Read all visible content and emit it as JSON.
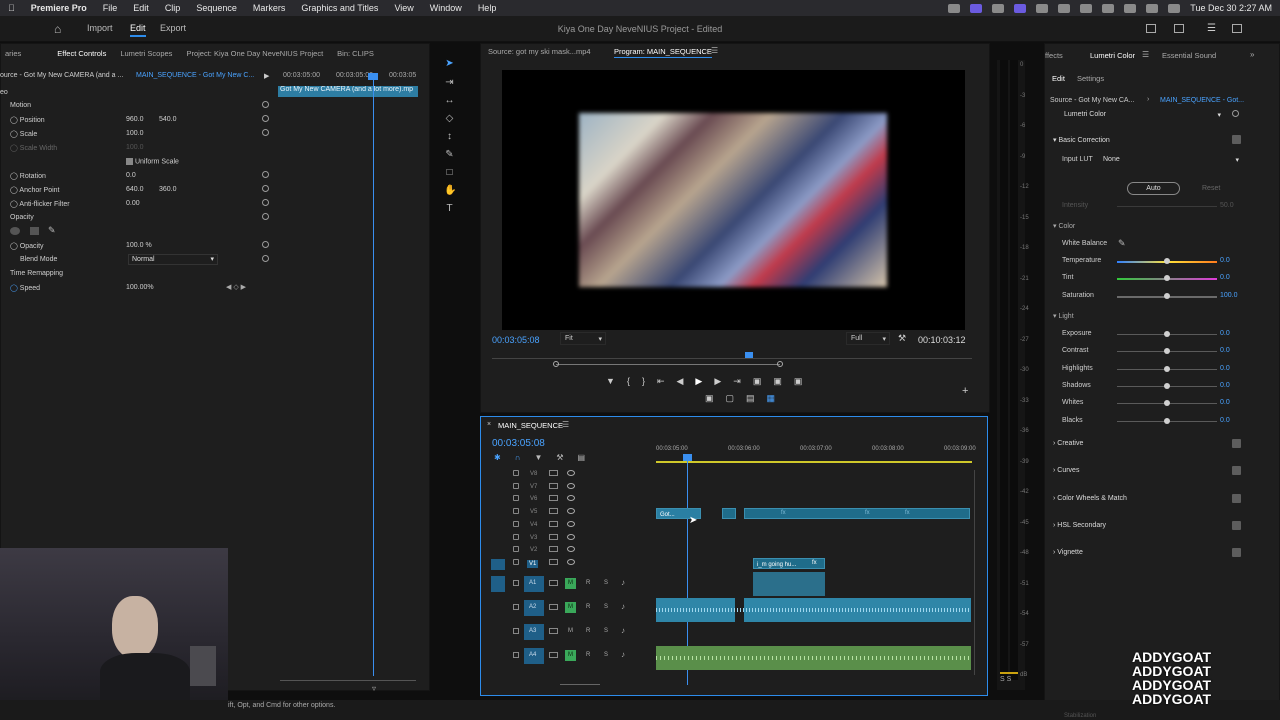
{
  "menubar": {
    "app": "Premiere Pro",
    "items": [
      "File",
      "Edit",
      "Clip",
      "Sequence",
      "Markers",
      "Graphics and Titles",
      "View",
      "Window",
      "Help"
    ],
    "clock": "Tue Dec 30  2:27 AM"
  },
  "header": {
    "tabs": [
      "Import",
      "Edit",
      "Export"
    ],
    "title": "Kiya One Day NeveNIUS Project - Edited"
  },
  "effect_controls": {
    "tabs": [
      "aries",
      "Effect Controls",
      "Lumetri Scopes",
      "Project: Kiya One Day NeveNIUS Project",
      "Bin: CLIPS"
    ],
    "source": "ource - Got My New CAMERA (and a ...",
    "sequence": "MAIN_SEQUENCE - Got My New C...",
    "times": [
      "00:03:05:00",
      "00:03:05:00",
      "00:03:05"
    ],
    "clip_label": "Got My New CAMERA (and a lot more).mp",
    "sections": {
      "motion": "Motion",
      "opacity": "Opacity",
      "time_remap": "Time Remapping",
      "video": "eo"
    },
    "props": [
      {
        "name": "Position",
        "v1": "960.0",
        "v2": "540.0"
      },
      {
        "name": "Scale",
        "v1": "100.0",
        "v2": ""
      },
      {
        "name": "Scale Width",
        "v1": "100.0",
        "v2": ""
      },
      {
        "name": "Rotation",
        "v1": "0.0",
        "v2": ""
      },
      {
        "name": "Anchor Point",
        "v1": "640.0",
        "v2": "360.0"
      },
      {
        "name": "Anti-flicker Filter",
        "v1": "0.00",
        "v2": ""
      }
    ],
    "uniform_scale": "Uniform Scale",
    "opacity_label": "Opacity",
    "opacity_value": "100.0 %",
    "blend_label": "Blend Mode",
    "blend_value": "Normal",
    "speed_label": "Speed",
    "speed_value": "100.00%"
  },
  "monitor": {
    "source_tab": "Source: got my ski mask...mp4",
    "program_tab": "Program: MAIN_SEQUENCE",
    "timecode": "00:03:05:08",
    "fit": "Fit",
    "quality": "Full",
    "duration": "00:10:03:12"
  },
  "timeline": {
    "name": "MAIN_SEQUENCE",
    "timecode": "00:03:05:08",
    "ruler": [
      "00:03:05:00",
      "00:03:06:00",
      "00:03:07:00",
      "00:03:08:00",
      "00:03:09:00"
    ],
    "video_tracks": [
      "V8",
      "V7",
      "V6",
      "V5",
      "V4",
      "V3",
      "V2",
      "V1"
    ],
    "audio_tracks": [
      "A1",
      "A2",
      "A3",
      "A4"
    ],
    "clip_v5": "Got...",
    "clip_v1": "i_m going hu...",
    "fx": "fx",
    "m": "M",
    "r": "R",
    "s": "S"
  },
  "audio_meter": {
    "ticks": [
      "0",
      "-3",
      "-6",
      "-9",
      "-12",
      "-15",
      "-18",
      "-21",
      "-24",
      "-27",
      "-30",
      "-33",
      "-36",
      "-39",
      "-42",
      "-45",
      "-48",
      "-51",
      "-54",
      "-57",
      "dB"
    ],
    "solo": "S  S"
  },
  "lumetri": {
    "tabs": [
      "ffects",
      "Lumetri Color",
      "Essential Sound"
    ],
    "subtabs": [
      "Edit",
      "Settings"
    ],
    "source": "Source - Got My New CA...",
    "sequence": "MAIN_SEQUENCE - Got...",
    "effect": "Lumetri Color",
    "basic": "Basic Correction",
    "input_lut_label": "Input LUT",
    "input_lut": "None",
    "auto": "Auto",
    "reset": "Reset",
    "intensity": "Intensity",
    "intensity_val": "50.0",
    "color": "Color",
    "white_balance": "White Balance",
    "light": "Light",
    "color_rows": [
      {
        "name": "Temperature",
        "value": "0.0"
      },
      {
        "name": "Tint",
        "value": "0.0"
      },
      {
        "name": "Saturation",
        "value": "100.0"
      }
    ],
    "light_rows": [
      {
        "name": "Exposure",
        "value": "0.0"
      },
      {
        "name": "Contrast",
        "value": "0.0"
      },
      {
        "name": "Highlights",
        "value": "0.0"
      },
      {
        "name": "Shadows",
        "value": "0.0"
      },
      {
        "name": "Whites",
        "value": "0.0"
      },
      {
        "name": "Blacks",
        "value": "0.0"
      }
    ],
    "sections": [
      "Creative",
      "Curves",
      "Color Wheels & Match",
      "HSL Secondary",
      "Vignette"
    ]
  },
  "status": {
    "hint": "ift, Opt, and Cmd for other options.",
    "watermark": [
      "ADDYGOAT",
      "ADDYGOAT",
      "ADDYGOAT",
      "ADDYGOAT"
    ],
    "stab": "Stabilization"
  }
}
